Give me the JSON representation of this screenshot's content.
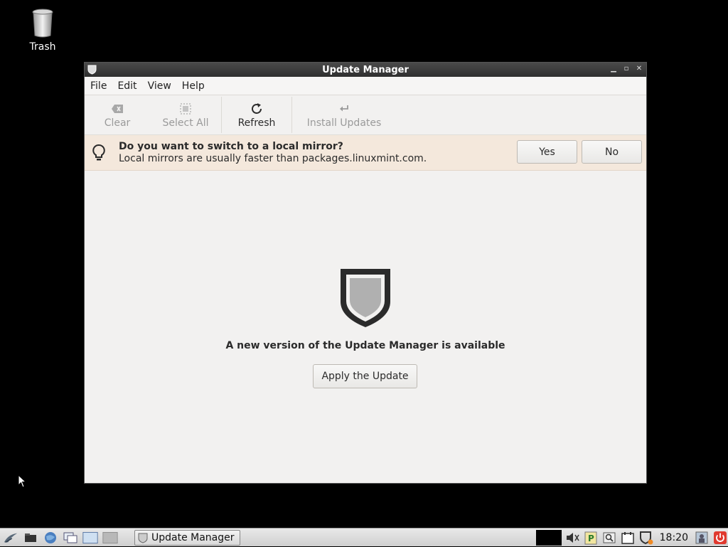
{
  "desktop": {
    "trash_label": "Trash"
  },
  "window": {
    "title": "Update Manager",
    "menu": [
      "File",
      "Edit",
      "View",
      "Help"
    ],
    "toolbar": {
      "clear": "Clear",
      "select_all": "Select All",
      "refresh": "Refresh",
      "install_updates": "Install Updates"
    },
    "infobar": {
      "question": "Do you want to switch to a local mirror?",
      "detail": "Local mirrors are usually faster than packages.linuxmint.com.",
      "yes": "Yes",
      "no": "No"
    },
    "content": {
      "headline": "A new version of the Update Manager is available",
      "apply_button": "Apply the Update"
    }
  },
  "taskbar": {
    "task_label": "Update Manager",
    "clock": "18:20"
  },
  "icons": [
    "trash-icon",
    "shield-icon",
    "bulb-icon",
    "refresh-icon",
    "clear-icon",
    "select-all-icon",
    "install-icon",
    "power-icon"
  ],
  "colors": {
    "infobar_bg": "#f4e8dc",
    "window_bg": "#f2f1f0",
    "titlebar_bg": "#3a3a3a",
    "power_red": "#e03a2f"
  }
}
